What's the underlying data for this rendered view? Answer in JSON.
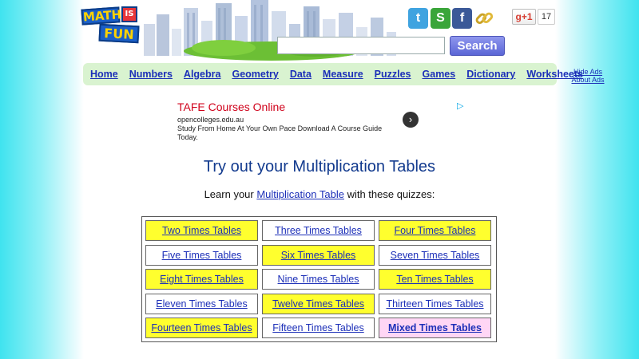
{
  "header": {
    "logo_words": [
      "MATH",
      "IS",
      "FUN"
    ],
    "search": {
      "placeholder": "",
      "value": "",
      "button_label": "Search"
    },
    "social": [
      {
        "name": "twitter",
        "glyph": "t",
        "color": "#3fa3e0"
      },
      {
        "name": "stumbleupon",
        "glyph": "S",
        "color": "#3aa53a"
      },
      {
        "name": "facebook",
        "glyph": "f",
        "color": "#3b5998"
      }
    ],
    "gplus_label": "g+1",
    "gplus_count": "17"
  },
  "nav": {
    "items": [
      "Home",
      "Numbers",
      "Algebra",
      "Geometry",
      "Data",
      "Measure",
      "Puzzles",
      "Games",
      "Dictionary",
      "Worksheets"
    ],
    "hide_ads": "Hide Ads",
    "about_ads": "About Ads"
  },
  "ad": {
    "title": "TAFE Courses Online",
    "domain": "opencolleges.edu.au",
    "description": "Study From Home At Your Own Pace Download A Course Guide Today."
  },
  "main": {
    "title": "Try out your Multiplication Tables",
    "intro_before": "Learn your ",
    "intro_link": "Multiplication Table",
    "intro_after": " with these quizzes:",
    "quizzes": [
      {
        "label": "Two Times Tables",
        "style": "yellow"
      },
      {
        "label": "Three Times Tables",
        "style": "white"
      },
      {
        "label": "Four Times Tables",
        "style": "yellow"
      },
      {
        "label": "Five Times Tables",
        "style": "white"
      },
      {
        "label": "Six Times Tables",
        "style": "yellow"
      },
      {
        "label": "Seven Times Tables",
        "style": "white"
      },
      {
        "label": "Eight Times Tables",
        "style": "yellow"
      },
      {
        "label": "Nine Times Tables",
        "style": "white"
      },
      {
        "label": "Ten Times Tables",
        "style": "yellow"
      },
      {
        "label": "Eleven Times Tables",
        "style": "white"
      },
      {
        "label": "Twelve Times Tables",
        "style": "yellow"
      },
      {
        "label": "Thirteen Times Tables",
        "style": "white"
      },
      {
        "label": "Fourteen Times Tables",
        "style": "yellow"
      },
      {
        "label": "Fifteen Times Tables",
        "style": "white"
      },
      {
        "label": "Mixed Times Tables",
        "style": "pink"
      }
    ]
  },
  "colors": {
    "link": "#1c2fb8",
    "title": "#123a8e",
    "nav_bg": "#d9f3d0",
    "yellow_cell": "#ffff2e",
    "pink_cell": "#ffd6f5",
    "ad_title": "#d0021b"
  }
}
